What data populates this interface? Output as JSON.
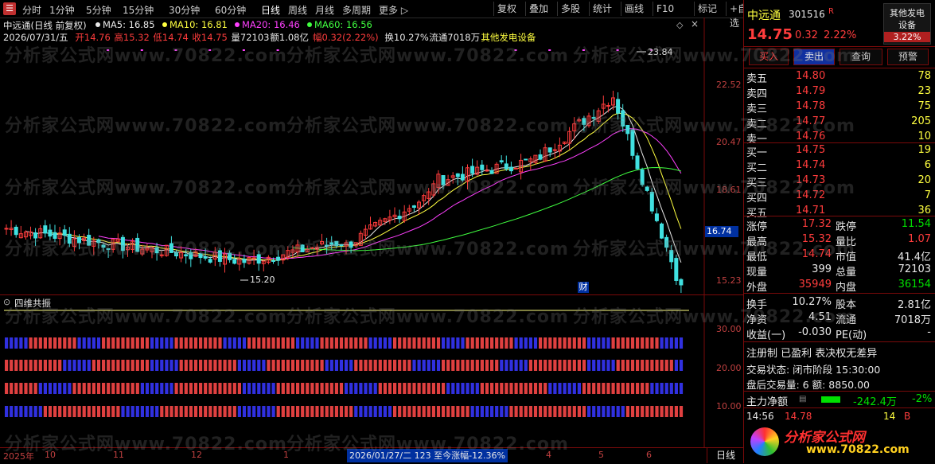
{
  "toolbar": {
    "periods": [
      "分时",
      "1分钟",
      "5分钟",
      "15分钟",
      "30分钟",
      "60分钟",
      "日线",
      "周线",
      "月线",
      "多周期",
      "更多 ▷"
    ],
    "active_period": "日线",
    "right_buttons": [
      "复权",
      "叠加",
      "多股",
      "统计",
      "画线",
      "F10",
      "标记",
      "+自选",
      "返回"
    ]
  },
  "chart_header": {
    "line1_name": "中远通(日线 前复权)",
    "ma_labels": [
      {
        "text": "MA5: 16.85",
        "color": "#e8e8e8"
      },
      {
        "text": "MA10: 16.81",
        "color": "#ffff40"
      },
      {
        "text": "MA20: 16.46",
        "color": "#ff40ff"
      },
      {
        "text": "MA60: 16.56",
        "color": "#40ff40"
      }
    ],
    "line2": [
      {
        "text": "2026/07/31/五",
        "color": "#e8e8e8"
      },
      {
        "text": "开14.76",
        "color": "#ff3c3c"
      },
      {
        "text": "高15.32",
        "color": "#ff3c3c"
      },
      {
        "text": "低14.74",
        "color": "#ff3c3c"
      },
      {
        "text": "收14.75",
        "color": "#ff3c3c"
      },
      {
        "text": "量72103",
        "color": "#e8e8e8"
      },
      {
        "text": "额1.08亿",
        "color": "#e8e8e8"
      },
      {
        "text": "幅0.32(2.22%)",
        "color": "#ff3c3c"
      },
      {
        "text": "换10.27%",
        "color": "#e8e8e8"
      },
      {
        "text": "流通7018万",
        "color": "#e8e8e8"
      },
      {
        "text": "其他发电设备",
        "color": "#ffff40"
      }
    ]
  },
  "price_axis": {
    "ticks": [
      "22.52",
      "20.47",
      "18.61",
      "16.74",
      "15.23"
    ],
    "current": "16.74",
    "high_mark": "23.84",
    "low_mark": "15.20",
    "cai_label": "财"
  },
  "indicator": {
    "title": "四维共振",
    "ticks": [
      "30.00",
      "20.00",
      "10.00"
    ],
    "rows": [
      {
        "level": 27,
        "color": "#e04040"
      },
      {
        "level": 20,
        "color": "#e04040"
      },
      {
        "level": 13,
        "color": "#e04040"
      },
      {
        "level": 6,
        "color": "#e04040"
      }
    ],
    "alt_color": "#3030e0"
  },
  "bottom": {
    "left_year": "2025年",
    "months": [
      "10",
      "11",
      "12",
      "1",
      "2",
      "3",
      "4",
      "5",
      "6"
    ],
    "info": "2026/01/27/二 123 至今涨幅-12.36%",
    "period_label": "日线"
  },
  "stock": {
    "name": "中远通",
    "code": "301516",
    "flag": "R",
    "sector_line1": "其他发电",
    "sector_line2": "设备",
    "sector_change": "3.22%",
    "price": "14.75",
    "change": "0.32",
    "change_pct": "2.22%",
    "actions": [
      "买入",
      "卖出",
      "查询",
      "预警"
    ]
  },
  "order_book": {
    "asks": [
      {
        "label": "卖五",
        "price": "14.80",
        "vol": "78"
      },
      {
        "label": "卖四",
        "price": "14.79",
        "vol": "23"
      },
      {
        "label": "卖三",
        "price": "14.78",
        "vol": "75"
      },
      {
        "label": "卖二",
        "price": "14.77",
        "vol": "205"
      },
      {
        "label": "卖一",
        "price": "14.76",
        "vol": "10"
      }
    ],
    "bids": [
      {
        "label": "买一",
        "price": "14.75",
        "vol": "19"
      },
      {
        "label": "买二",
        "price": "14.74",
        "vol": "6"
      },
      {
        "label": "买三",
        "price": "14.73",
        "vol": "20"
      },
      {
        "label": "买四",
        "price": "14.72",
        "vol": "7"
      },
      {
        "label": "买五",
        "price": "14.71",
        "vol": "36"
      }
    ]
  },
  "stats": [
    {
      "l1": "涨停",
      "v1": "17.32",
      "c1": "red",
      "l2": "跌停",
      "v2": "11.54",
      "c2": "green"
    },
    {
      "l1": "最高",
      "v1": "15.32",
      "c1": "red",
      "l2": "量比",
      "v2": "1.07",
      "c2": "red"
    },
    {
      "l1": "最低",
      "v1": "14.74",
      "c1": "red",
      "l2": "市值",
      "v2": "41.4亿",
      "c2": "wht"
    },
    {
      "l1": "现量",
      "v1": "399",
      "c1": "wht",
      "l2": "总量",
      "v2": "72103",
      "c2": "wht"
    },
    {
      "l1": "外盘",
      "v1": "35949",
      "c1": "red",
      "l2": "内盘",
      "v2": "36154",
      "c2": "green"
    }
  ],
  "stats2": [
    {
      "l1": "换手",
      "v1": "10.27%",
      "l2": "股本",
      "v2": "2.81亿"
    },
    {
      "l1": "净资",
      "v1": "4.51",
      "l2": "流通",
      "v2": "7018万"
    },
    {
      "l1": "收益(一)",
      "v1": "-0.030",
      "l2": "PE(动)",
      "v2": "-"
    }
  ],
  "extra": {
    "registration": "注册制 已盈利 表决权无差异",
    "trade_status": "交易状态: 闭市阶段 15:30:00",
    "after_hours": "盘后交易量: 6 额: 8850.00",
    "main_net_label": "主力净额",
    "main_net_value": "-242.4万",
    "main_net_pct": "-2%",
    "tick_time": "14:56",
    "tick_price": "14.78",
    "tick_vol": "14",
    "tick_side": "B"
  },
  "watermark": "分析家公式网www.70822.com",
  "logo_text": "分析家公式网",
  "logo_url": "www.70822.com"
}
